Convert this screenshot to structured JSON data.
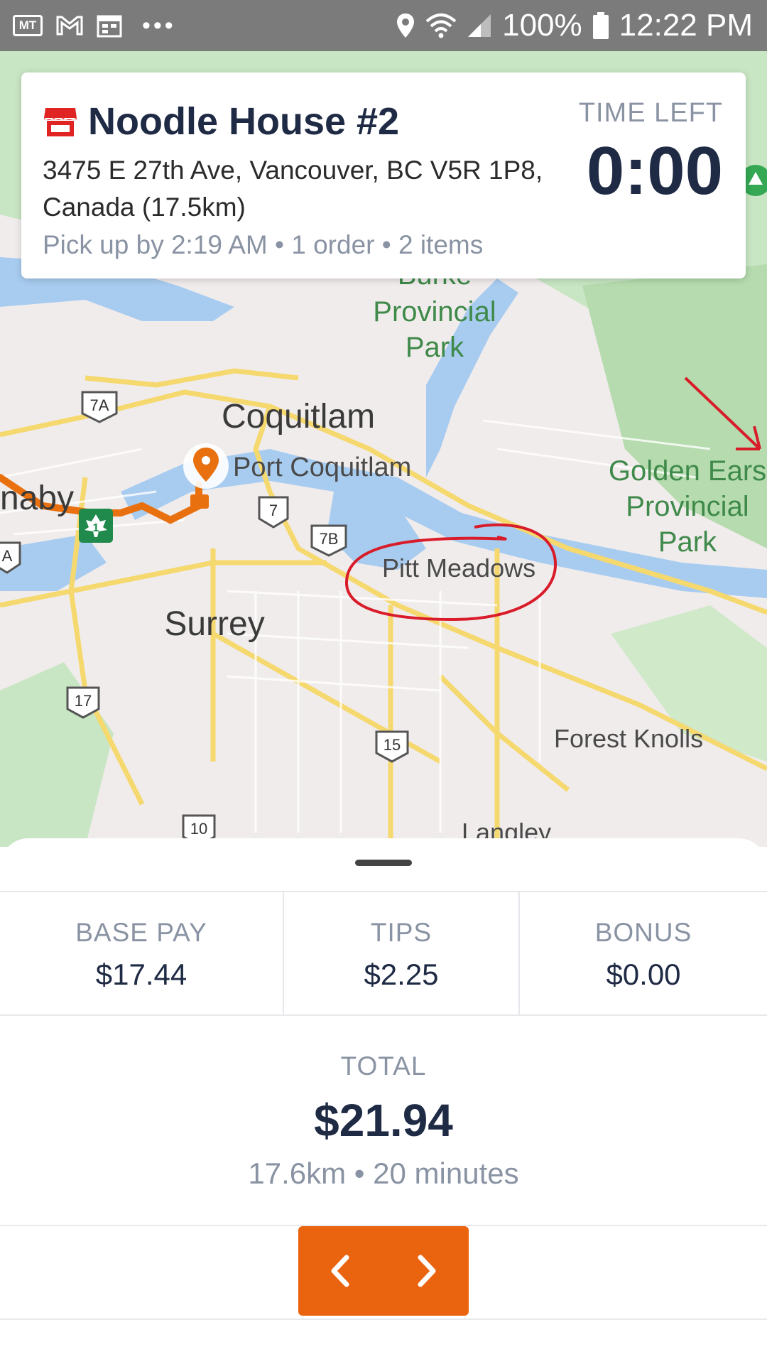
{
  "status_bar": {
    "left_icons": [
      "mt-delivered-icon",
      "gmail-icon",
      "calendar-icon",
      "more-dots-icon"
    ],
    "right_icons": [
      "location-icon",
      "wifi-icon",
      "signal-icon",
      "battery-icon"
    ],
    "battery": "100%",
    "time": "12:22 PM"
  },
  "order": {
    "store_name": "Noodle House #2",
    "address": "3475 E 27th Ave, Vancouver, BC V5R 1P8, Canada (17.5km)",
    "pickup": "Pick up by 2:19 AM • 1 order • 2 items",
    "time_left_label": "TIME LEFT",
    "time_left_value": "0:00"
  },
  "map": {
    "labels": {
      "burke": "Burke",
      "provincial": "Provincial",
      "park": "Park",
      "coquitlam": "Coquitlam",
      "port_coquitlam": "Port Coquitlam",
      "burnaby": "naby",
      "pitt_meadows": "Pitt Meadows",
      "golden_ears": "Golden Ears",
      "golden_provincial": "Provincial",
      "golden_park": "Park",
      "surrey": "Surrey",
      "forest_knolls": "Forest Knolls",
      "langley": "Langley"
    },
    "shields": [
      "7A",
      "7",
      "7B",
      "17",
      "15",
      "10",
      "A",
      "1"
    ],
    "colors": {
      "land": "#f1ecec",
      "park": "#c8e6c3",
      "water": "#a8ccf0",
      "road": "#f5d86e",
      "route": "#e8700f",
      "annotation": "#d81c2a"
    }
  },
  "earnings": {
    "base_pay_label": "BASE PAY",
    "base_pay_value": "$17.44",
    "tips_label": "TIPS",
    "tips_value": "$2.25",
    "bonus_label": "BONUS",
    "bonus_value": "$0.00",
    "total_label": "TOTAL",
    "total_value": "$21.94",
    "total_meta": "17.6km • 20 minutes"
  },
  "brand_color": "#ea6410"
}
